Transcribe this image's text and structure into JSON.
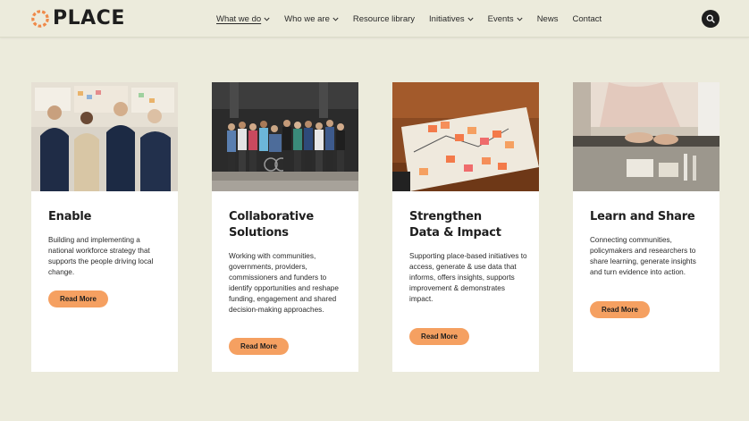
{
  "brand": {
    "name": "PLACE",
    "accent": "#f5a061",
    "ring_color": "#ef8a4a"
  },
  "nav": {
    "items": [
      {
        "label": "What we do",
        "has_dropdown": true,
        "active": true
      },
      {
        "label": "Who we are",
        "has_dropdown": true
      },
      {
        "label": "Resource library",
        "has_dropdown": false
      },
      {
        "label": "Initiatives",
        "has_dropdown": true
      },
      {
        "label": "Events",
        "has_dropdown": true
      },
      {
        "label": "News",
        "has_dropdown": false
      },
      {
        "label": "Contact",
        "has_dropdown": false
      }
    ],
    "search_icon": "search-icon"
  },
  "cards": [
    {
      "title": "Enable",
      "text": "Building and implementing a national workforce strategy that supports the people driving local change.",
      "button": "Read More",
      "image": "people-in-front-of-board-photo"
    },
    {
      "title": "Collaborative Solutions",
      "text": "Working with communities, governments, providers, commissioners and funders to identify opportunities and reshape funding, engagement and shared decision-making approaches.",
      "button": "Read More",
      "image": "group-photo-in-shed"
    },
    {
      "title": "Strengthen Data & Impact",
      "text": "Supporting place-based initiatives to access, generate & use data that informs, offers insights, supports improvement & demonstrates impact.",
      "button": "Read More",
      "image": "sticky-notes-map-photo"
    },
    {
      "title": "Learn and Share",
      "text": "Connecting communities, policymakers and researchers to share learning, generate insights and turn evidence into action.",
      "button": "Read More",
      "image": "hands-on-table-photo"
    }
  ]
}
